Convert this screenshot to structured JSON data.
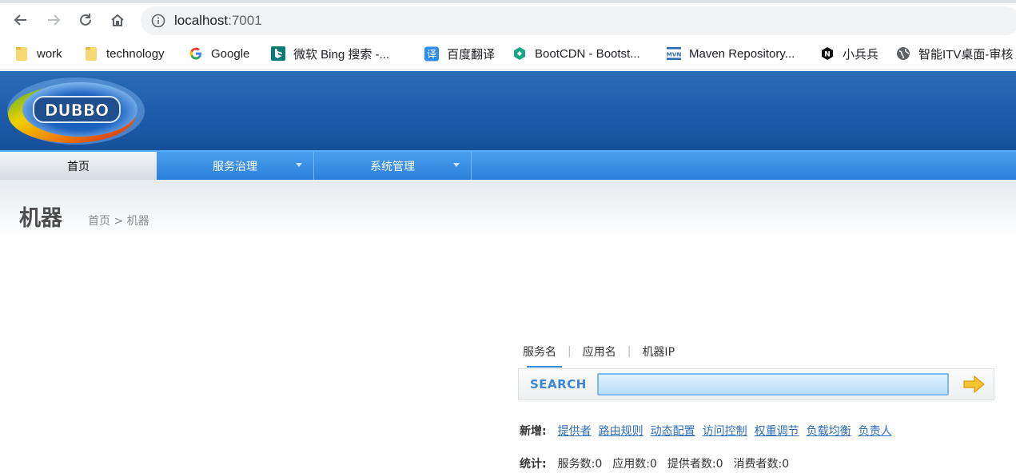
{
  "browser": {
    "url_host": "localhost",
    "url_port": ":7001",
    "bookmarks": [
      {
        "label": "work",
        "icon": "folder-icon"
      },
      {
        "label": "technology",
        "icon": "folder-icon"
      },
      {
        "label": "Google",
        "icon": "google-icon"
      },
      {
        "label": "微软 Bing 搜索 -...",
        "icon": "bing-icon"
      },
      {
        "label": "百度翻译",
        "icon": "baidu-translate-icon"
      },
      {
        "label": "BootCDN - Bootst...",
        "icon": "bootcdn-icon"
      },
      {
        "label": "Maven Repository...",
        "icon": "maven-icon"
      },
      {
        "label": "小兵兵",
        "icon": "n-hexagon-icon"
      },
      {
        "label": "智能ITV桌面-审核",
        "icon": "globe-icon"
      }
    ]
  },
  "header": {
    "logo_text": "DUBBO"
  },
  "nav": {
    "items": [
      {
        "label": "首页"
      },
      {
        "label": "服务治理"
      },
      {
        "label": "系统管理"
      }
    ]
  },
  "page": {
    "title": "机器",
    "breadcrumb": "首页 > 机器"
  },
  "search": {
    "tabs": [
      "服务名",
      "应用名",
      "机器IP"
    ],
    "label": "SEARCH",
    "value": ""
  },
  "add": {
    "label": "新增:",
    "links": [
      "提供者",
      "路由规则",
      "动态配置",
      "访问控制",
      "权重调节",
      "负载均衡",
      "负责人"
    ]
  },
  "stats": {
    "label": "统计:",
    "items": [
      "服务数:0",
      "应用数:0",
      "提供者数:0",
      "消费者数:0"
    ]
  },
  "colors": {
    "header_blue": "#1a58a6",
    "nav_blue": "#2b7fd9",
    "link_blue": "#2f6db5"
  }
}
